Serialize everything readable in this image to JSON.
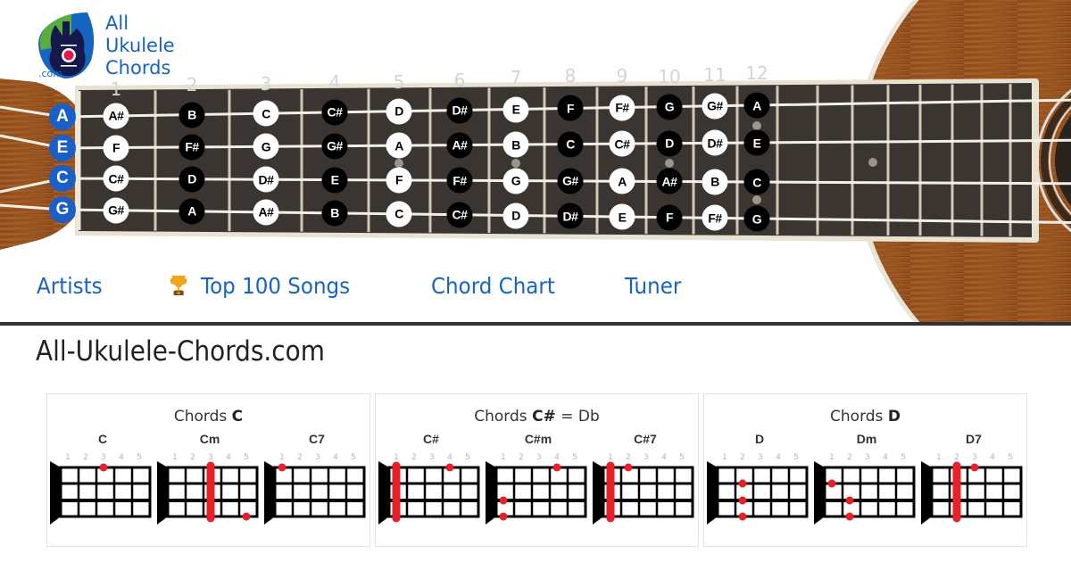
{
  "logo": {
    "lines": [
      "All",
      "Ukulele",
      "Chords"
    ],
    "suffix": ".com",
    "icon": "ukulele-pick-logo-icon",
    "colors": {
      "blue": "#1565c0",
      "green": "#5aad3c",
      "navy": "#14184a",
      "pink": "#e8174a"
    }
  },
  "fretboard": {
    "fret_numbers": [
      "1",
      "2",
      "3",
      "4",
      "5",
      "6",
      "7",
      "8",
      "9",
      "10",
      "11",
      "12"
    ],
    "open_strings": [
      "A",
      "E",
      "C",
      "G"
    ],
    "notes": [
      [
        "A#",
        "F",
        "C#",
        "G#"
      ],
      [
        "B",
        "F#",
        "D",
        "A"
      ],
      [
        "C",
        "G",
        "D#",
        "A#"
      ],
      [
        "C#",
        "G#",
        "E",
        "B"
      ],
      [
        "D",
        "A",
        "F",
        "C"
      ],
      [
        "D#",
        "A#",
        "F#",
        "C#"
      ],
      [
        "E",
        "B",
        "G",
        "D"
      ],
      [
        "F",
        "C",
        "G#",
        "D#"
      ],
      [
        "F#",
        "C#",
        "A",
        "E"
      ],
      [
        "G",
        "D",
        "A#",
        "F"
      ],
      [
        "G#",
        "D#",
        "B",
        "F#"
      ],
      [
        "A",
        "E",
        "C",
        "G"
      ]
    ],
    "note_style_by_fret": [
      "white",
      "black",
      "white",
      "black",
      "white",
      "black",
      "white",
      "black",
      "white",
      "black",
      "white",
      "black"
    ],
    "colors": {
      "open_string": "#1a5fc7"
    }
  },
  "nav": {
    "items": [
      {
        "label": "Artists",
        "icon": null
      },
      {
        "label": "Top 100 Songs",
        "icon": "trophy-icon"
      },
      {
        "label": "Chord Chart",
        "icon": null
      },
      {
        "label": "Tuner",
        "icon": null
      }
    ],
    "link_color": "#1565c0"
  },
  "site_title": "All-Ukulele-Chords.com",
  "fret_labels": [
    "1",
    "2",
    "3",
    "4",
    "5"
  ],
  "chord_groups": [
    {
      "title_prefix": "Chords",
      "root": "C",
      "alias": "",
      "chords": [
        {
          "name": "C",
          "barre": null,
          "dots": [
            {
              "string": 1,
              "fret": 3
            }
          ]
        },
        {
          "name": "Cm",
          "barre": 3,
          "dots": [
            {
              "string": 4,
              "fret": 5
            }
          ]
        },
        {
          "name": "C7",
          "barre": null,
          "dots": [
            {
              "string": 1,
              "fret": 1
            }
          ]
        }
      ]
    },
    {
      "title_prefix": "Chords",
      "root": "C#",
      "alias": "= Db",
      "chords": [
        {
          "name": "C#",
          "barre": 1,
          "dots": [
            {
              "string": 1,
              "fret": 4
            }
          ]
        },
        {
          "name": "C#m",
          "barre": null,
          "dots": [
            {
              "string": 1,
              "fret": 4
            },
            {
              "string": 3,
              "fret": 1
            },
            {
              "string": 4,
              "fret": 1
            }
          ]
        },
        {
          "name": "C#7",
          "barre": 1,
          "dots": [
            {
              "string": 1,
              "fret": 2
            }
          ]
        }
      ]
    },
    {
      "title_prefix": "Chords",
      "root": "D",
      "alias": "",
      "chords": [
        {
          "name": "D",
          "barre": null,
          "dots": [
            {
              "string": 2,
              "fret": 2
            },
            {
              "string": 3,
              "fret": 2
            },
            {
              "string": 4,
              "fret": 2
            }
          ]
        },
        {
          "name": "Dm",
          "barre": null,
          "dots": [
            {
              "string": 2,
              "fret": 1
            },
            {
              "string": 3,
              "fret": 2
            },
            {
              "string": 4,
              "fret": 2
            }
          ]
        },
        {
          "name": "D7",
          "barre": 2,
          "dots": [
            {
              "string": 1,
              "fret": 3
            }
          ]
        }
      ]
    }
  ],
  "colors": {
    "dot": "#e8202a",
    "divider": "#2f3133",
    "panel_border": "#e2e2ee",
    "fret_label": "#b0b0b0"
  }
}
